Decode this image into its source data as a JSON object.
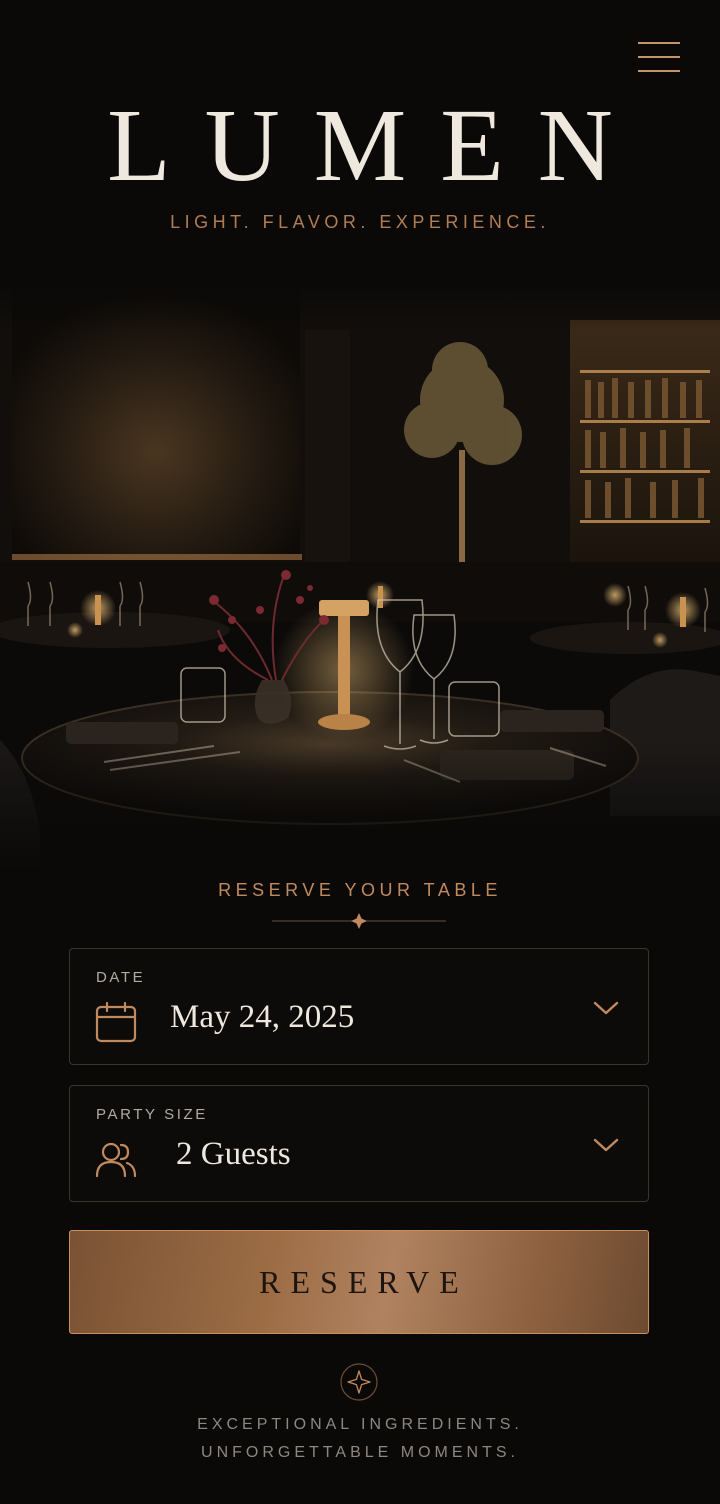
{
  "header": {
    "menu_icon": "hamburger-menu-icon",
    "brand": "LUMEN",
    "tagline": "LIGHT. FLAVOR. EXPERIENCE."
  },
  "hero": {
    "description_icon": "restaurant-interior-image"
  },
  "reservation": {
    "heading": "RESERVE YOUR TABLE",
    "date": {
      "label": "DATE",
      "value": "May 24, 2025",
      "icon": "calendar-icon"
    },
    "party_size": {
      "label": "PARTY SIZE",
      "value": "2 Guests",
      "icon": "people-icon"
    },
    "submit_label": "RESERVE"
  },
  "footer": {
    "line1": "EXCEPTIONAL INGREDIENTS.",
    "line2": "UNFORGETTABLE MOMENTS."
  },
  "colors": {
    "background": "#0a0908",
    "accent": "#c08a5e",
    "button_gold": "#9c6d45",
    "text_light": "#efe8df"
  }
}
